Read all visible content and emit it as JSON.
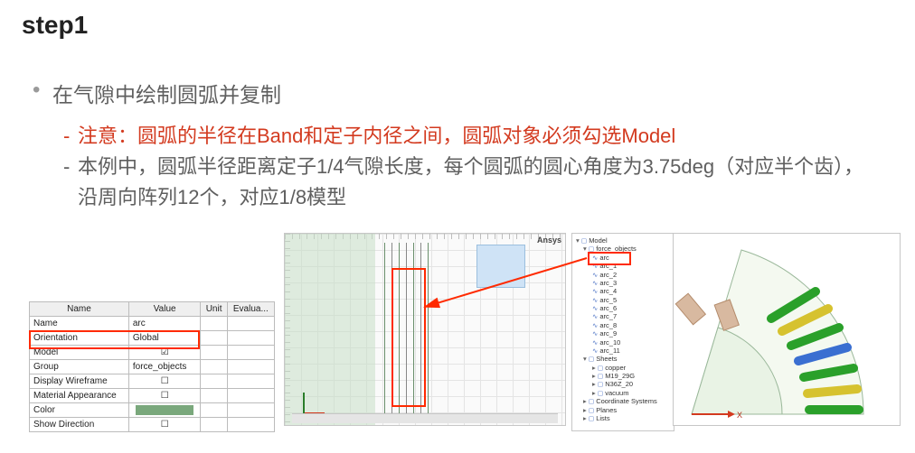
{
  "title": "step1",
  "bullets": {
    "main": "在气隙中绘制圆弧并复制",
    "note_red": "注意：圆弧的半径在Band和定子内径之间，圆弧对象必须勾选Model",
    "detail_gray": "本例中，圆弧半径距离定子1/4气隙长度，每个圆弧的圆心角度为3.75deg（对应半个齿），沿周向阵列12个，对应1/8模型"
  },
  "prop_table": {
    "headers": [
      "Name",
      "Value",
      "Unit",
      "Evalua..."
    ],
    "rows": [
      {
        "name": "Name",
        "value": "arc",
        "type": "text"
      },
      {
        "name": "Orientation",
        "value": "Global",
        "type": "text"
      },
      {
        "name": "Model",
        "value": true,
        "type": "check"
      },
      {
        "name": "Group",
        "value": "force_objects",
        "type": "text"
      },
      {
        "name": "Display Wireframe",
        "value": false,
        "type": "check"
      },
      {
        "name": "Material Appearance",
        "value": false,
        "type": "check"
      },
      {
        "name": "Color",
        "value": "#7aa87c",
        "type": "color"
      },
      {
        "name": "Show Direction",
        "value": false,
        "type": "check"
      }
    ],
    "highlight_row": 2
  },
  "model_view": {
    "brand": "Ansys"
  },
  "tree": {
    "root": "Model",
    "group": "force_objects",
    "arc_item": "arc",
    "arcs": [
      "arc_1",
      "arc_2",
      "arc_3",
      "arc_4",
      "arc_5",
      "arc_6",
      "arc_7",
      "arc_8",
      "arc_9",
      "arc_10",
      "arc_11"
    ],
    "sheets_header": "Sheets",
    "sheets": [
      "copper",
      "M19_29G",
      "N36Z_20",
      "vacuum"
    ],
    "other": [
      "Coordinate Systems",
      "Planes",
      "Lists"
    ]
  },
  "right_axis": {
    "x": "X"
  }
}
